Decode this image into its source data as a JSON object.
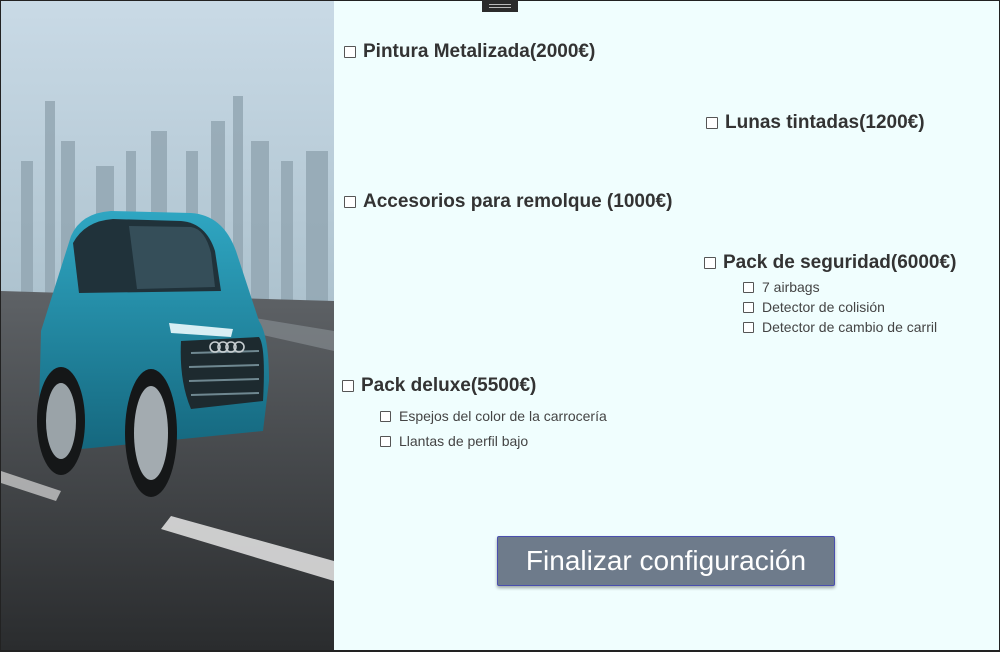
{
  "image": {
    "alt": "Audi e-tron SUV",
    "icon": "car-photo"
  },
  "options": [
    {
      "label": "Pintura Metalizada(2000€)"
    },
    {
      "label": "Lunas tintadas(1200€)"
    },
    {
      "label": "Accesorios para remolque (1000€)"
    },
    {
      "label": "Pack de seguridad(6000€)",
      "items": [
        {
          "label": "7 airbags"
        },
        {
          "label": "Detector de colisión"
        },
        {
          "label": "Detector de cambio de carril"
        }
      ]
    },
    {
      "label": "Pack deluxe(5500€)",
      "items": [
        {
          "label": "Espejos del color de la carrocería"
        },
        {
          "label": "Llantas de perfil bajo"
        }
      ]
    }
  ],
  "button": {
    "label": "Finalizar configuración"
  },
  "colors": {
    "background": "#f0fefe",
    "button": "#6e7b8b",
    "button_border": "#4a4fae",
    "text": "#333333"
  }
}
